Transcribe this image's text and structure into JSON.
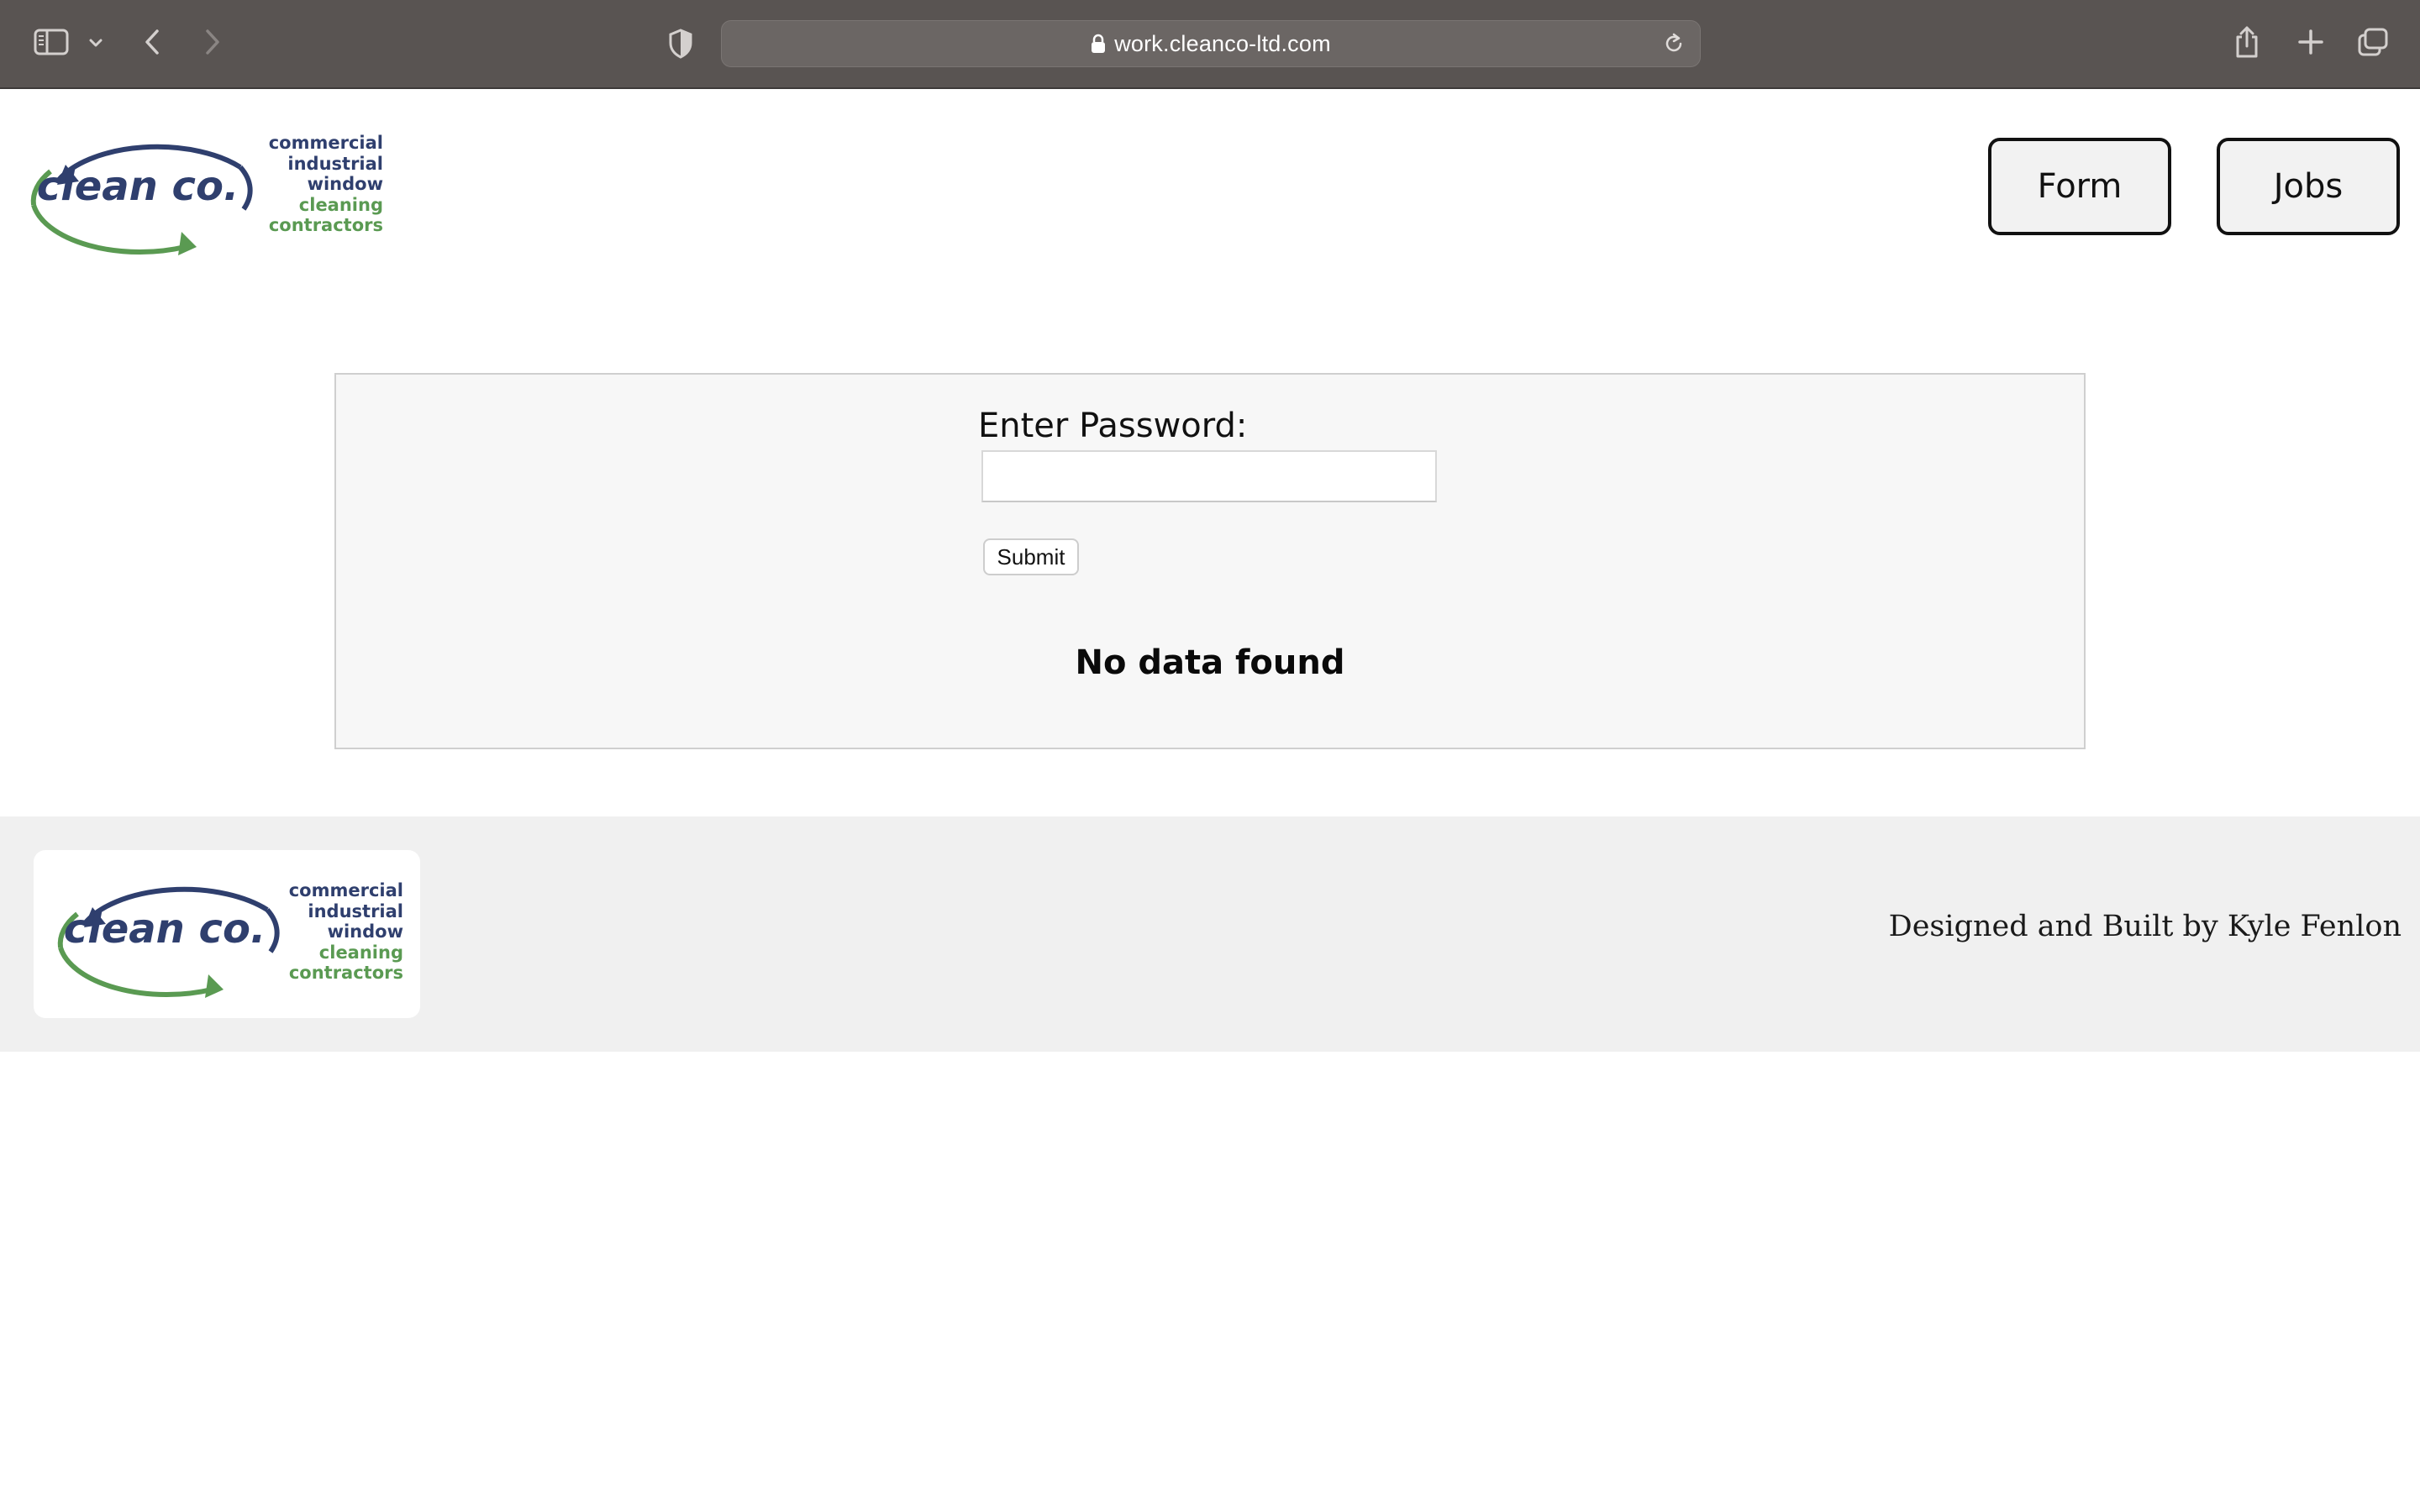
{
  "browser": {
    "url": "work.cleanco-ltd.com",
    "icons": {
      "sidebar": "sidebar-icon",
      "chevron": "chevron-down-icon",
      "back": "back-arrow-icon",
      "forward": "forward-arrow-icon",
      "privacy": "privacy-shield-icon",
      "lock": "lock-icon",
      "reload": "reload-icon",
      "share": "share-icon",
      "new_tab": "plus-icon",
      "tabs": "tabs-overview-icon"
    }
  },
  "header": {
    "logo": {
      "wordmark": "clean co.",
      "lines": [
        "commercial",
        "industrial",
        "window",
        "cleaning",
        "contractors"
      ]
    },
    "nav": [
      {
        "label": "Form"
      },
      {
        "label": "Jobs"
      }
    ]
  },
  "main": {
    "password_label": "Enter Password:",
    "password_value": "",
    "submit_label": "Submit",
    "status_message": "No data found"
  },
  "footer": {
    "logo": {
      "wordmark": "clean co.",
      "lines": [
        "commercial",
        "industrial",
        "window",
        "cleaning",
        "contractors"
      ]
    },
    "credit": "Designed and Built by Kyle Fenlon"
  },
  "colors": {
    "chrome_bg": "#595452",
    "logo_blue": "#2f3f6e",
    "logo_green": "#5a9a52",
    "footer_bg": "#f0f0f0",
    "panel_bg": "#f7f7f7"
  }
}
